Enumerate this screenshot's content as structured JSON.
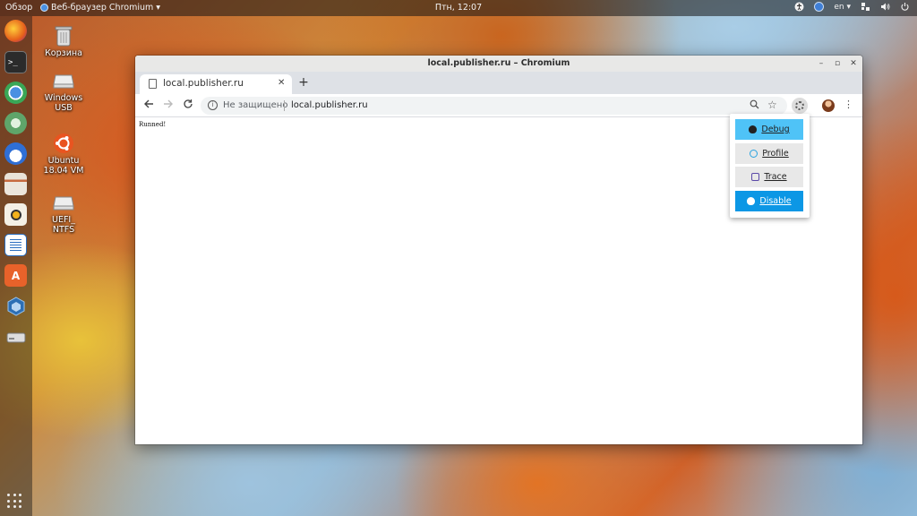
{
  "topbar": {
    "overview": "Обзор",
    "app_name": "Веб-браузер Chromium ▾",
    "clock": "Птн, 12:07",
    "lang": "en ▾",
    "icons": [
      "accessibility-icon",
      "chromium-status-icon",
      "network-icon",
      "volume-icon",
      "power-icon"
    ]
  },
  "dock": {
    "items": [
      "firefox-icon",
      "terminal-icon",
      "chromium-icon",
      "settings-icon",
      "thunderbird-icon",
      "files-icon",
      "rhythmbox-icon",
      "writer-icon",
      "software-center-icon",
      "virtualbox-icon",
      "drive-icon"
    ],
    "apps_grid": "show-applications-icon"
  },
  "desktop": {
    "icons": [
      {
        "label": "Корзина"
      },
      {
        "label": "Windows USB"
      },
      {
        "label": "Ubuntu 18.04 VM"
      },
      {
        "label": "UEFI_ NTFS"
      }
    ]
  },
  "window": {
    "title": "local.publisher.ru – Chromium",
    "tab_title": "local.publisher.ru",
    "tab_close": "✕",
    "new_tab": "+",
    "omnibox": {
      "security": "Не защищено",
      "url": "local.publisher.ru"
    },
    "page_text": "Runned!"
  },
  "popup": {
    "debug": "Debug",
    "profile": "Profile",
    "trace": "Trace",
    "disable": "Disable",
    "colors": {
      "debug": "#4fc3f7",
      "disable": "#0c97e5",
      "neutral": "#e8e8e8"
    }
  }
}
